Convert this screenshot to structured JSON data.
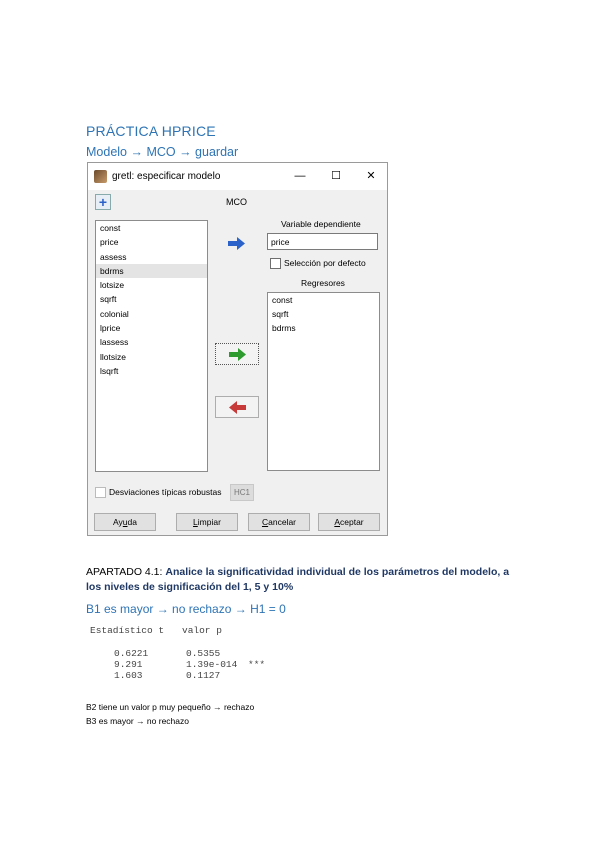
{
  "doc": {
    "title": "PRÁCTICA HPRICE",
    "subtitle": "Modelo → MCO → guardar",
    "apartado_label": "APARTADO 4.1: ",
    "apartado_text": "Analice la significatividad individual de los parámetros del modelo, a los niveles de significación del 1, 5 y 10%",
    "b1_line": "B1 es mayor → no rechazo → H1 = 0",
    "b2_line": "B2 tiene un valor p muy pequeño → rechazo",
    "b3_line": "B3 es mayor → no rechazo"
  },
  "dialog": {
    "window_title": "gretl: especificar modelo",
    "minimize": "—",
    "maximize": "☐",
    "close": "✕",
    "heading": "MCO",
    "variables": [
      "const",
      "price",
      "assess",
      "bdrms",
      "lotsize",
      "sqrft",
      "colonial",
      "lprice",
      "lassess",
      "llotsize",
      "lsqrft"
    ],
    "selected_variable": "bdrms",
    "dependent_label": "Variable dependiente",
    "dependent_value": "price",
    "default_selection_label": "Selección por defecto",
    "regressors_label": "Regresores",
    "regressors": [
      "const",
      "sqrft",
      "bdrms"
    ],
    "robust_label": "Desviaciones típicas robustas",
    "hc1": "HC1",
    "buttons": {
      "help_pre": "Ay",
      "help_ul": "u",
      "help_post": "da",
      "clear_ul": "L",
      "clear_post": "impiar",
      "cancel_ul": "C",
      "cancel_post": "ancelar",
      "ok_ul": "A",
      "ok_post": "ceptar"
    },
    "icon_colors": {
      "dep_arrow": "#2a62c9",
      "add_arrow": "#2e9b2e",
      "remove_arrow": "#c83a3a"
    }
  },
  "stats": {
    "headers": [
      "Estadístico t",
      "valor p"
    ],
    "rows": [
      [
        "0.6221",
        "0.5355",
        ""
      ],
      [
        "9.291",
        "1.39e-014",
        "***"
      ],
      [
        "1.603",
        "0.1127",
        ""
      ]
    ]
  }
}
